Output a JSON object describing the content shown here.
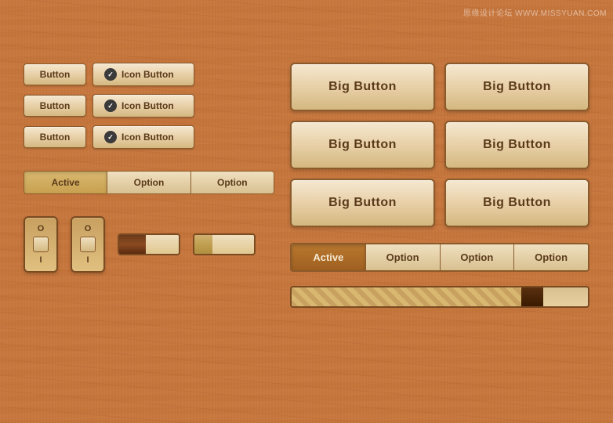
{
  "watermark": "思缘设计论坛  WWW.MISSYUAN.COM",
  "left": {
    "button_rows": [
      {
        "btn_label": "Button",
        "icon_btn_label": "Icon Button"
      },
      {
        "btn_label": "Button",
        "icon_btn_label": "Icon Button"
      },
      {
        "btn_label": "Button",
        "icon_btn_label": "Icon Button"
      }
    ],
    "tabs_small": {
      "items": [
        {
          "label": "Active",
          "active": true
        },
        {
          "label": "Option",
          "active": false
        },
        {
          "label": "Option",
          "active": false
        }
      ]
    },
    "toggle1": {
      "top_label": "O",
      "bottom_label": "I"
    },
    "toggle2": {
      "top_label": "O",
      "bottom_label": "I"
    },
    "slider1": {
      "filled_pct": 45
    },
    "slider2": {
      "filled_pct": 30
    }
  },
  "right": {
    "big_buttons": [
      {
        "label": "Big Button"
      },
      {
        "label": "Big Button"
      },
      {
        "label": "Big Button"
      },
      {
        "label": "Big Button"
      },
      {
        "label": "Big Button"
      },
      {
        "label": "Big Button"
      }
    ],
    "tabs_large": {
      "items": [
        {
          "label": "Active",
          "active": true
        },
        {
          "label": "Option",
          "active": false
        },
        {
          "label": "Option",
          "active": false
        },
        {
          "label": "Option",
          "active": false
        }
      ]
    },
    "progress": {
      "fill_pct": 85
    }
  }
}
